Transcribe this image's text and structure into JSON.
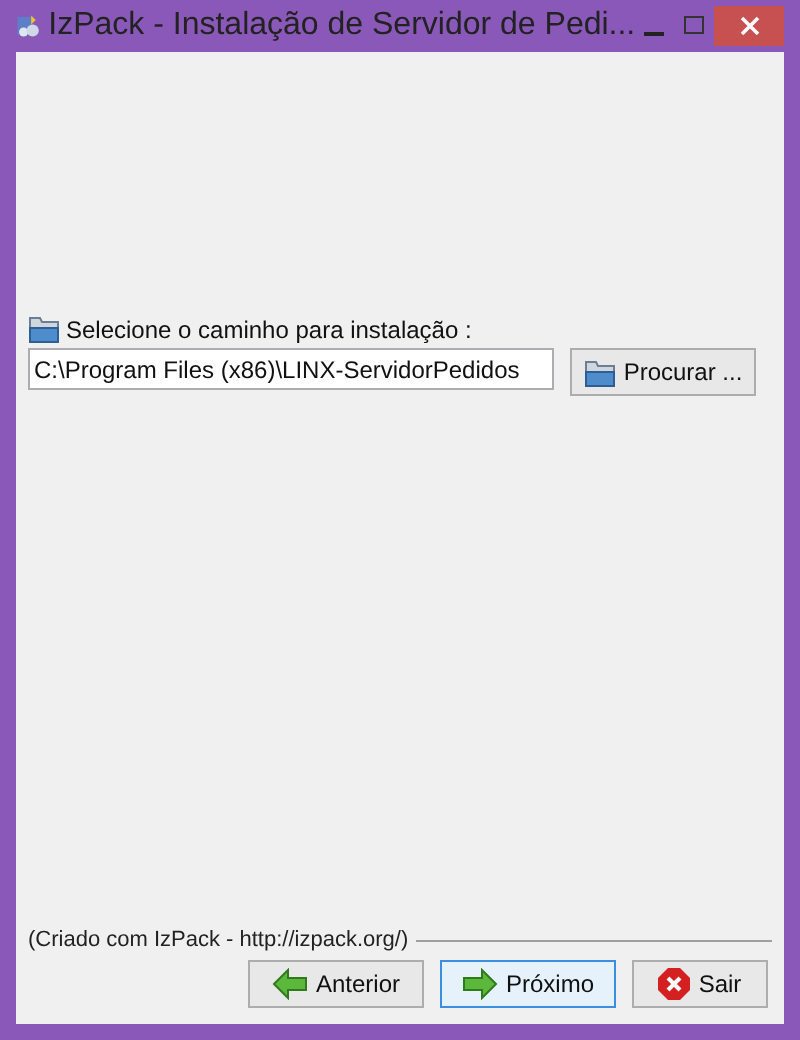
{
  "window": {
    "title": "IzPack - Instalação de Servidor de Pedi..."
  },
  "path_selector": {
    "label": "Selecione o caminho para instalação :",
    "value": "C:\\Program Files (x86)\\LINX-ServidorPedidos",
    "browse_button": "Procurar ..."
  },
  "footer": {
    "credit": "(Criado com IzPack - http://izpack.org/)"
  },
  "buttons": [
    {
      "kind": "back",
      "label": "Anterior",
      "focused": false
    },
    {
      "kind": "next",
      "label": "Próximo",
      "focused": true
    },
    {
      "kind": "quit",
      "label": "Sair",
      "focused": false
    }
  ]
}
